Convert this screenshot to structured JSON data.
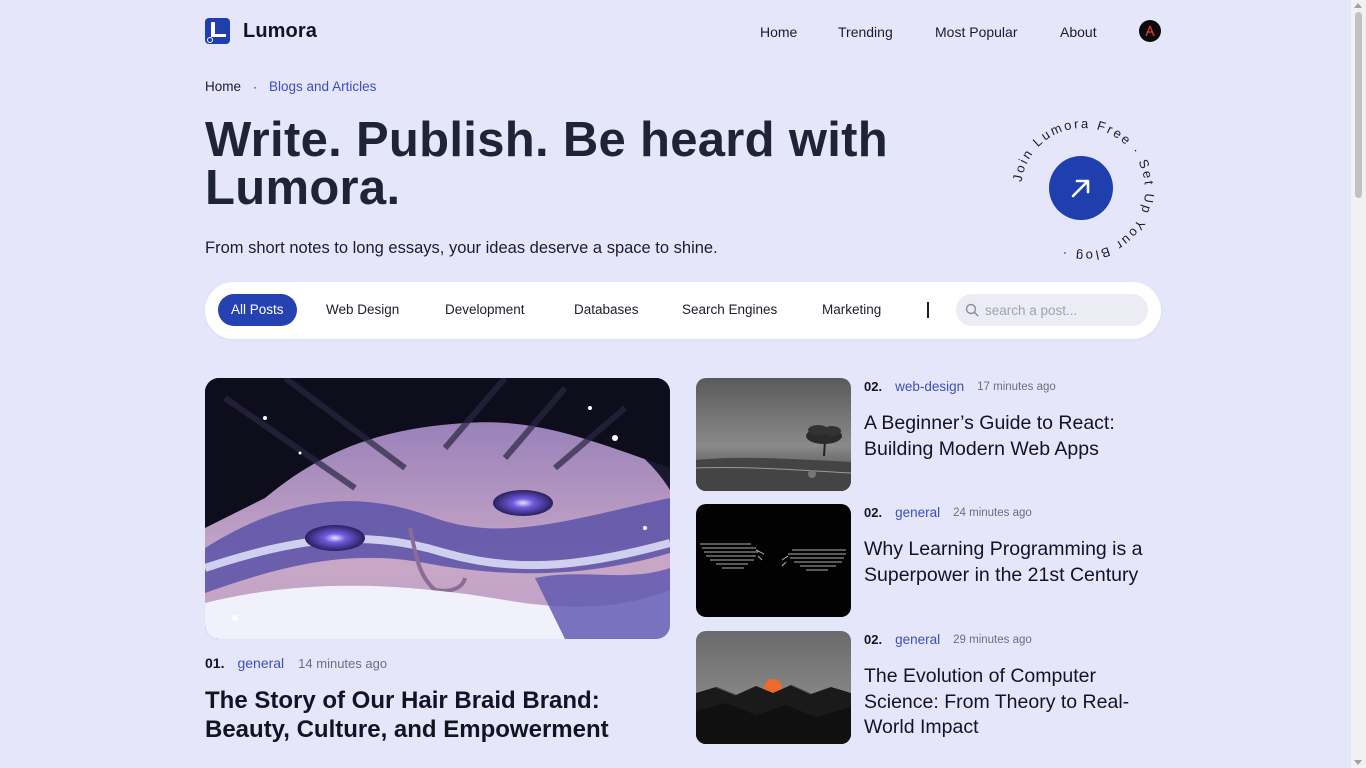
{
  "brand": {
    "name": "Lumora"
  },
  "nav": {
    "items": [
      {
        "label": "Home"
      },
      {
        "label": "Trending"
      },
      {
        "label": "Most Popular"
      },
      {
        "label": "About"
      }
    ]
  },
  "breadcrumb": {
    "home": "Home",
    "separator": "·",
    "current": "Blogs and Articles"
  },
  "hero": {
    "title": "Write. Publish. Be heard with Lumora.",
    "subtitle": "From short notes to long essays, your ideas deserve a space to shine.",
    "badge_ring_text": "Join Lumora Free · Set Up Your Blog ·"
  },
  "filters": {
    "chips": [
      {
        "label": "All Posts",
        "active": true
      },
      {
        "label": "Web Design"
      },
      {
        "label": "Development"
      },
      {
        "label": "Databases"
      },
      {
        "label": "Search Engines"
      },
      {
        "label": "Marketing"
      }
    ],
    "search_placeholder": "search a post..."
  },
  "featured": {
    "num": "01.",
    "category": "general",
    "time": "14 minutes ago",
    "title": "The Story of Our Hair Braid Brand: Beauty, Culture, and Empowerment",
    "image": "woman-eyes-snow-illustration"
  },
  "posts": [
    {
      "num": "02.",
      "category": "web-design",
      "time": "17 minutes ago",
      "title": "A Beginner’s Guide to React: Building Modern Web Apps",
      "image": "misty-tree-landscape"
    },
    {
      "num": "02.",
      "category": "general",
      "time": "24 minutes ago",
      "title": "Why Learning Programming is a Superpower in the 21st Century",
      "image": "digital-hands-reaching"
    },
    {
      "num": "02.",
      "category": "general",
      "time": "29 minutes ago",
      "title": "The Evolution of Computer Science: From Theory to Real-World Impact",
      "image": "orange-sun-dark-mountains"
    }
  ],
  "colors": {
    "background": "#e6e6fb",
    "accent": "#2541b2",
    "link": "#3a50b8",
    "text": "#111522"
  }
}
